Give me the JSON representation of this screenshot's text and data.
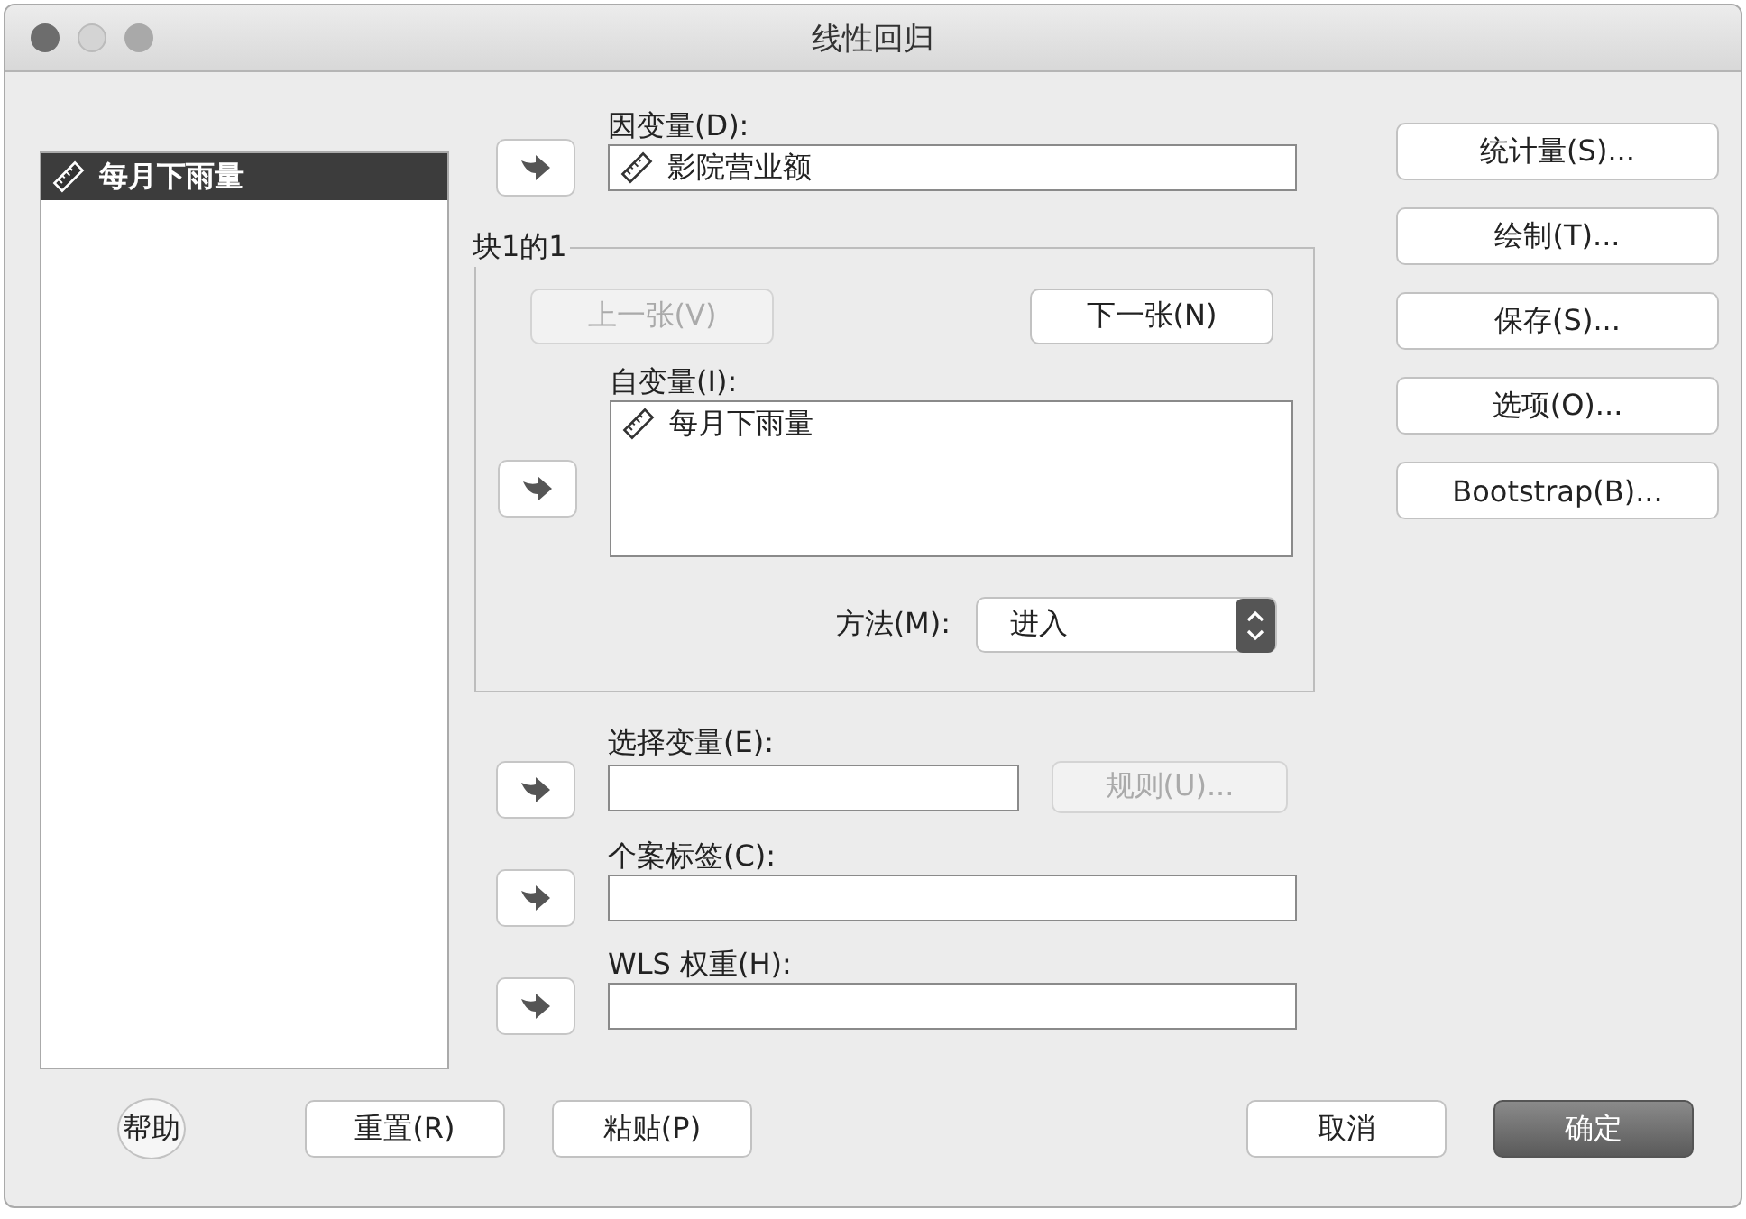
{
  "window": {
    "title": "线性回归"
  },
  "source_list": {
    "items": [
      {
        "label": "每月下雨量",
        "selected": true
      }
    ]
  },
  "dependent": {
    "label": "因变量(D):",
    "value": "影院营业额"
  },
  "block": {
    "title": "块1的1",
    "nav_buttons": [
      {
        "label": "上一张(V)",
        "disabled": true
      },
      {
        "label": "下一张(N)",
        "disabled": false
      }
    ],
    "independent": {
      "label": "自变量(I):",
      "items": [
        "每月下雨量"
      ]
    },
    "method": {
      "label": "方法(M):",
      "value": "进入"
    }
  },
  "selection": {
    "label": "选择变量(E):",
    "rule_button": {
      "label": "规则(U)...",
      "disabled": true
    }
  },
  "case_labels": {
    "label": "个案标签(C):"
  },
  "wls_weight": {
    "label": "WLS 权重(H):"
  },
  "side_buttons": [
    "统计量(S)...",
    "绘制(T)...",
    "保存(S)...",
    "选项(O)...",
    "Bootstrap(B)..."
  ],
  "footer": {
    "help": "帮助",
    "buttons": [
      {
        "label": "重置(R)",
        "default": false
      },
      {
        "label": "粘贴(P)",
        "default": false
      },
      {
        "label": "取消",
        "default": false
      },
      {
        "label": "确定",
        "default": true
      }
    ]
  }
}
